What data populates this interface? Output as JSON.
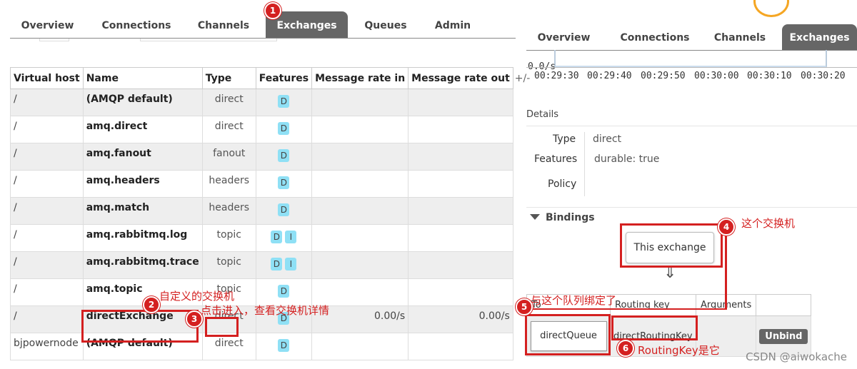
{
  "nav": {
    "tabs": [
      "Overview",
      "Connections",
      "Channels",
      "Exchanges",
      "Queues",
      "Admin"
    ],
    "active": "Exchanges"
  },
  "table": {
    "headers": [
      "Virtual host",
      "Name",
      "Type",
      "Features",
      "Message rate in",
      "Message rate out",
      "+/-"
    ],
    "rows": [
      {
        "vhost": "/",
        "name": "(AMQP default)",
        "type": "direct",
        "features": [
          "D"
        ],
        "in": "",
        "out": ""
      },
      {
        "vhost": "/",
        "name": "amq.direct",
        "type": "direct",
        "features": [
          "D"
        ],
        "in": "",
        "out": ""
      },
      {
        "vhost": "/",
        "name": "amq.fanout",
        "type": "fanout",
        "features": [
          "D"
        ],
        "in": "",
        "out": ""
      },
      {
        "vhost": "/",
        "name": "amq.headers",
        "type": "headers",
        "features": [
          "D"
        ],
        "in": "",
        "out": ""
      },
      {
        "vhost": "/",
        "name": "amq.match",
        "type": "headers",
        "features": [
          "D"
        ],
        "in": "",
        "out": ""
      },
      {
        "vhost": "/",
        "name": "amq.rabbitmq.log",
        "type": "topic",
        "features": [
          "D",
          "I"
        ],
        "in": "",
        "out": ""
      },
      {
        "vhost": "/",
        "name": "amq.rabbitmq.trace",
        "type": "topic",
        "features": [
          "D",
          "I"
        ],
        "in": "",
        "out": ""
      },
      {
        "vhost": "/",
        "name": "amq.topic",
        "type": "topic",
        "features": [
          "D"
        ],
        "in": "",
        "out": ""
      },
      {
        "vhost": "/",
        "name": "directExchange",
        "type": "direct",
        "features": [
          "D"
        ],
        "in": "0.00/s",
        "out": "0.00/s"
      },
      {
        "vhost": "bjpowernode",
        "name": "(AMQP default)",
        "type": "direct",
        "features": [
          "D"
        ],
        "in": "",
        "out": ""
      }
    ]
  },
  "right": {
    "tabs": [
      "Overview",
      "Connections",
      "Channels",
      "Exchanges"
    ],
    "active": "Exchanges",
    "rate_label": "0.0/s",
    "times": [
      "00:29:30",
      "00:29:40",
      "00:29:50",
      "00:30:00",
      "00:30:10",
      "00:30:20"
    ],
    "details_title": "Details",
    "details": {
      "type_label": "Type",
      "type_value": "direct",
      "features_label": "Features",
      "features_value": "durable: true",
      "policy_label": "Policy"
    },
    "bindings_title": "Bindings",
    "this_exchange": "This exchange",
    "arrow": "⇓",
    "binding_headers": [
      "To",
      "Routing key",
      "Arguments"
    ],
    "binding": {
      "to": "directQueue",
      "routing_key": "directRoutingKey",
      "action": "Unbind"
    }
  },
  "annotations": {
    "n1": "1",
    "n2": "2",
    "n3": "3",
    "n4": "4",
    "n5": "5",
    "n6": "6",
    "note2": "自定义的交换机",
    "note3": "点击进入，查看交换机详情",
    "note4": "这个交换机",
    "note5": "与这个队列绑定了",
    "note6": "RoutingKey是它"
  },
  "watermark": "CSDN @aiwokache",
  "colors": {
    "accent_red": "#d42020",
    "tab_active": "#666666",
    "badge": "#8fe0f5"
  }
}
